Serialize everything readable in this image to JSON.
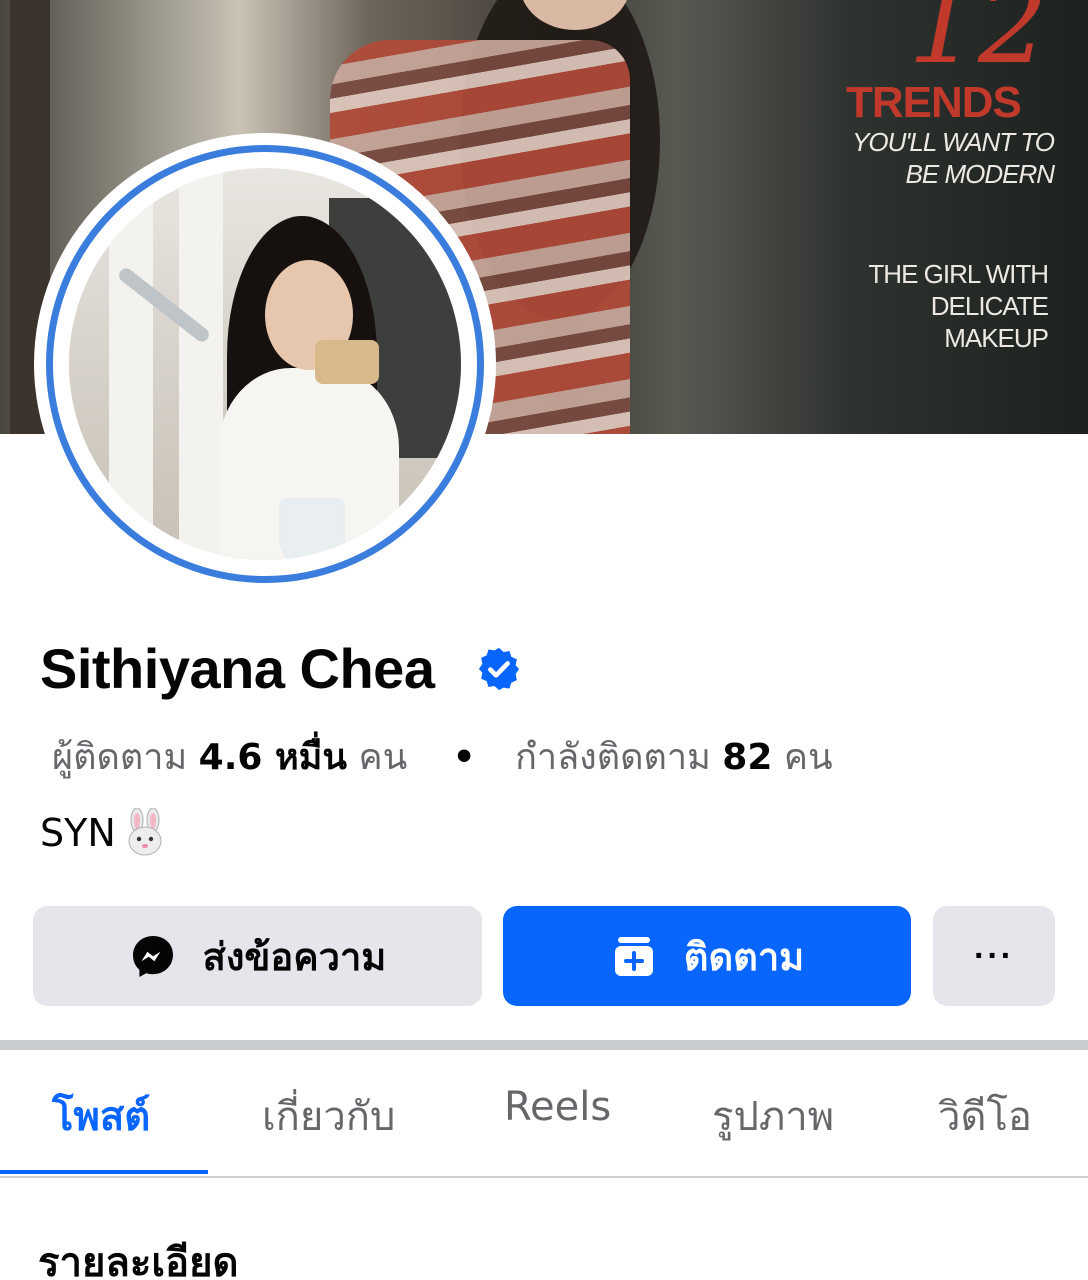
{
  "cover": {
    "number": "12",
    "headline": "TRENDS",
    "subline_1": "YOU'LL WANT TO BE MODERN",
    "subline_2": "THE GIRL WITH DELICATE MAKEUP"
  },
  "profile": {
    "name": "Sithiyana Chea",
    "verified_icon": "verified-badge-icon",
    "followers_label": "ผู้ติดตาม",
    "followers_count": "4.6 หมื่น",
    "followers_unit": "คน",
    "separator": "•",
    "following_label": "กำลังติดตาม",
    "following_count": "82",
    "following_unit": "คน",
    "bio_text": "SYN",
    "bio_emoji": "rabbit-face-icon"
  },
  "actions": {
    "message_label": "ส่งข้อความ",
    "message_icon": "messenger-icon",
    "follow_label": "ติดตาม",
    "follow_icon": "follow-add-icon",
    "more_label": "···"
  },
  "tabs": [
    {
      "label": "โพสต์",
      "active": true
    },
    {
      "label": "เกี่ยวกับ",
      "active": false
    },
    {
      "label": "Reels",
      "active": false
    },
    {
      "label": "รูปภาพ",
      "active": false
    },
    {
      "label": "วิดีโอ",
      "active": false
    }
  ],
  "details": {
    "title": "รายละเอียด"
  },
  "colors": {
    "accent": "#0866ff",
    "button_grey": "#e4e6eb",
    "secondary_text": "#65676b",
    "story_ring": "#3b7ddd"
  }
}
